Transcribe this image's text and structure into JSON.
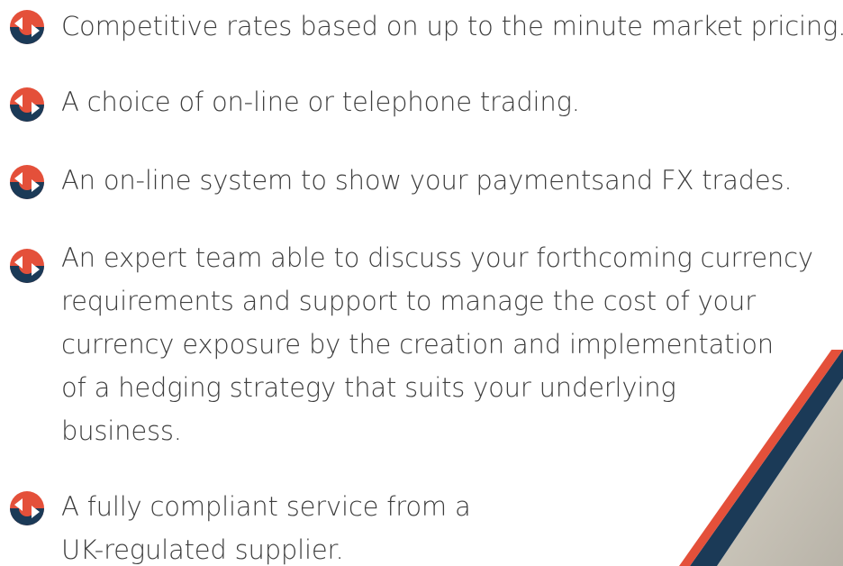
{
  "colors": {
    "icon_orange": "#e4503a",
    "icon_navy": "#1b3a57",
    "text": "#3d3d3d"
  },
  "bullet_icon": "circular-arrows-icon",
  "features": [
    {
      "lines": [
        "Competitive rates based on up to the minute market pricing."
      ]
    },
    {
      "lines": [
        "A choice of on-line or telephone trading."
      ]
    },
    {
      "lines": [
        "An on-line system to show your paymentsand FX trades."
      ]
    },
    {
      "lines": [
        "An expert team able to discuss your forthcoming currency",
        "requirements and support to manage the cost of your",
        "currency exposure by the creation and implementation",
        "of a hedging strategy that suits your underlying",
        "business."
      ]
    },
    {
      "lines": [
        "A fully compliant service from a",
        "UK-regulated supplier."
      ]
    }
  ]
}
